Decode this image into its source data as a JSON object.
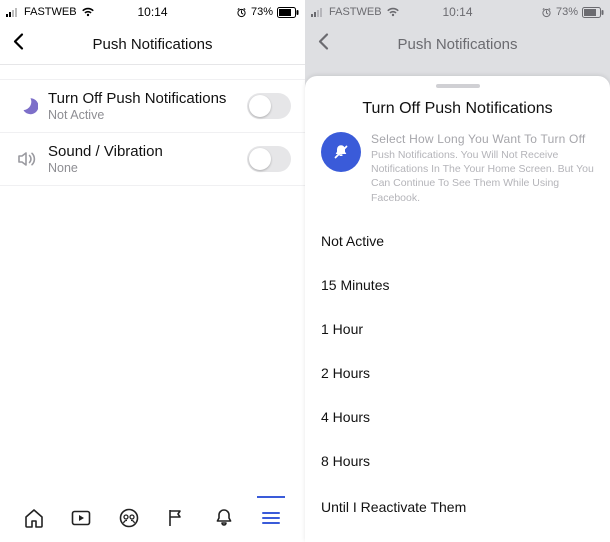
{
  "statusbar": {
    "carrier": "FASTWEB",
    "time": "10:14",
    "battery_pct": "73%"
  },
  "left": {
    "title": "Push Notifications",
    "rows": {
      "turnoff": {
        "title": "Turn Off Push Notifications",
        "sub": "Not Active"
      },
      "sound": {
        "title": "Sound / Vibration",
        "sub": "None"
      }
    }
  },
  "right": {
    "title": "Push Notifications",
    "sheet": {
      "title": "Turn Off Push Notifications",
      "info_head": "Select How Long You Want To Turn Off",
      "info_body": "Push Notifications. You Will Not Receive Notifications In The Your Home Screen. But You Can Continue To See Them While Using Facebook.",
      "options": {
        "active": "Not Active",
        "m15": "15 Minutes",
        "h1": "1 Hour",
        "h2": "2 Hours",
        "h4": "4 Hours",
        "h8": "8 Hours",
        "until": "Until I Reactivate Them"
      }
    }
  }
}
